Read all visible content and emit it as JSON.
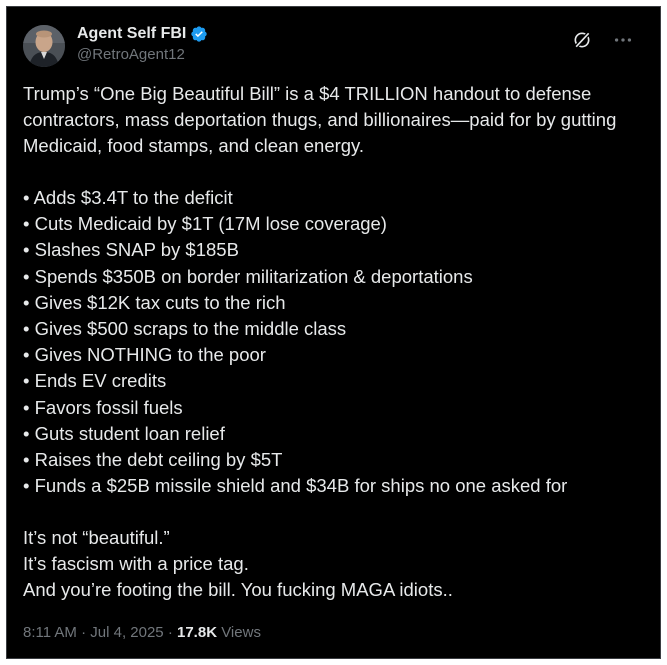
{
  "tweet": {
    "display_name": "Agent Self FBI",
    "handle": "@RetroAgent12",
    "verified_color": "#1d9bf0",
    "avatar_icon": "profile-photo",
    "grok_icon": "grok-slash-icon",
    "more_icon": "more-dots-icon",
    "intro": "Trump’s “One Big Beautiful Bill” is a $4 TRILLION handout to defense contractors, mass deportation thugs, and billionaires—paid for by gutting Medicaid, food stamps, and clean energy.",
    "bullets": [
      "• Adds $3.4T to the deficit",
      "• Cuts Medicaid by $1T (17M lose coverage)",
      "• Slashes SNAP by $185B",
      "• Spends $350B on border militarization & deportations",
      "• Gives $12K tax cuts to the rich",
      "• Gives $500 scraps to the middle class",
      "• Gives NOTHING to the poor",
      "• Ends EV credits",
      "• Favors fossil fuels",
      "• Guts student loan relief",
      "• Raises the debt ceiling by $5T",
      "• Funds a $25B missile shield and $34B for ships no one asked for"
    ],
    "outro": [
      "It’s not “beautiful.”",
      "It’s fascism with a price tag.",
      "And you’re footing the bill. You fucking MAGA idiots.."
    ],
    "time": "8:11 AM",
    "separator": "·",
    "date": "Jul 4, 2025",
    "views_count": "17.8K",
    "views_label": "Views"
  }
}
